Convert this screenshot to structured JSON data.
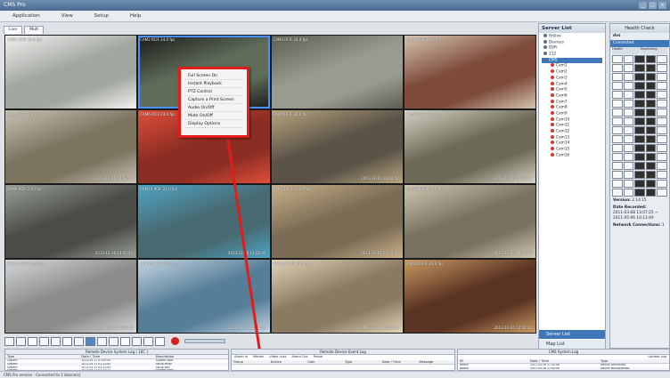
{
  "app": {
    "title": "CMS Pro",
    "win_controls": [
      "_",
      "□",
      "×"
    ]
  },
  "menu": [
    "Application",
    "View",
    "Setup",
    "Help"
  ],
  "tabs": [
    "Live",
    "Mult"
  ],
  "cameras": [
    {
      "label": "CAM1 RCIF 24.0 fps",
      "time": "",
      "bg": "#a1a6a0",
      "accent": "#f2f2f0"
    },
    {
      "label": "CAM2 RCIF 24.0 fps",
      "time": "",
      "bg": "#5f6c5a",
      "accent": "#1a1a18",
      "selected": true
    },
    {
      "label": "CAM3 RCIF 24.0 fps",
      "time": "",
      "bg": "#9a9b90",
      "accent": "#5b5e52"
    },
    {
      "label": "CAM4 RCIF 24.0 fps",
      "time": "",
      "bg": "#7e4a39",
      "accent": "#d5c5b2"
    },
    {
      "label": "CAM5 RCIF 24.0 fps",
      "time": "2013-12-16  14:02:42",
      "bg": "#7d7460",
      "accent": "#c9c3b4"
    },
    {
      "label": "CAM6 RCIF 24.0 fps",
      "time": "",
      "bg": "#8c2d23",
      "accent": "#e14e3a"
    },
    {
      "label": "CAM7 RCIF 24.0 fps",
      "time": "2013-12-16  14:02:42",
      "bg": "#5b5348",
      "accent": "#b9a67e"
    },
    {
      "label": "CAM8 RCIF 24.0 fps",
      "time": "2013-12-16  14:02:42",
      "bg": "#6e6a58",
      "accent": "#d7d3c5"
    },
    {
      "label": "CAM9 RCIF 24.0 fps",
      "time": "2013-12-16  14:02:42",
      "bg": "#4a4c48",
      "accent": "#9aa09a"
    },
    {
      "label": "CAM10 RCIF 24.0 fps",
      "time": "2013-12-16  14:02:42",
      "bg": "#486a72",
      "accent": "#4fa5c6"
    },
    {
      "label": "CAM11 RCIF 24.0 fps",
      "time": "2013-12-16  14:02:42",
      "bg": "#7b6b55",
      "accent": "#c9b18a"
    },
    {
      "label": "CAM12 RCIF 24.0 fps",
      "time": "2013-12-16  14:02:42",
      "bg": "#7a7260",
      "accent": "#d1c8b3"
    },
    {
      "label": "CAM13 RCIF 24.0 fps",
      "time": "2013-12-16  14:02:42",
      "bg": "#8b8c8a",
      "accent": "#d5d8da"
    },
    {
      "label": "CAM14 RCIF 24.0 fps",
      "time": "2013-12-16  14:02:42",
      "bg": "#567e98",
      "accent": "#c6d6e2"
    },
    {
      "label": "CAM15 RCIF 24.0 fps",
      "time": "2013-12-16  14:02:42",
      "bg": "#8a7a62",
      "accent": "#e1d3b8"
    },
    {
      "label": "CAM16 RCIF 24.0 fps",
      "time": "2013-12-16  14:02:42",
      "bg": "#5a3322",
      "accent": "#c99a62"
    }
  ],
  "context_menu": [
    "Full Screen On",
    "Instant Playback",
    "PTZ Control",
    "Capture a Print Screen",
    "Audio On/Off",
    "Mute On/Off",
    "Display Options"
  ],
  "server_list": {
    "title": "Server List",
    "nodes": [
      "Online",
      "Devices",
      "DVR",
      "212",
      "CMS",
      "Cam1",
      "Cam2",
      "Cam3",
      "Cam4",
      "Cam5",
      "Cam6",
      "Cam7",
      "Cam8",
      "Cam9",
      "Cam10",
      "Cam11",
      "Cam12",
      "Cam13",
      "Cam14",
      "Cam15",
      "Cam16"
    ],
    "tabs": [
      "Server List",
      "Map List"
    ]
  },
  "health": {
    "title": "Health Check",
    "server": "dvs",
    "status": "Connected",
    "col_health": "Health",
    "col_monitoring": "Monitoring",
    "version_label": "Version:",
    "version": "2.14.15",
    "date_label": "Date Recorded:",
    "date_value": "2011-03-08 13:07:25 ~ 2011-05-06 10:13:49",
    "network_label": "Network Connections:",
    "network_value": "1"
  },
  "sys_log": {
    "title": "Remote Device System Log ( 16C )",
    "cols": [
      "Type",
      "Date / Time",
      "Description"
    ],
    "rows": [
      [
        "System",
        "2011-05-17 01:00:00",
        "System start"
      ],
      [
        "System",
        "2011-05-17 01:12:00",
        "Setup enter"
      ],
      [
        "System",
        "2011-05-17 01:12:03",
        "Setup exit"
      ],
      [
        "System",
        "2011-05-17 01:12:11",
        "System start"
      ],
      [
        "System",
        "2011-05-17 01:12:17",
        "System shutdown"
      ],
      [
        "System",
        "2011-05-17 03:40:40",
        "Setup enter"
      ],
      [
        "System",
        "2011-05-17 03:41:06",
        "Setup exit"
      ],
      [
        "System",
        "2011-05-17 03:50:09",
        "System start"
      ],
      [
        "System",
        "2011-05-17 03:50:09",
        "System start"
      ]
    ]
  },
  "event_log": {
    "title": "Remote Device Event Log",
    "filters": [
      "Alarm In",
      "Motion",
      "Video Loss",
      "Alarm Out"
    ],
    "pause": "Pause",
    "cols": [
      "Group",
      "Device",
      "Cam",
      "Type",
      "Date / Time",
      "Message"
    ]
  },
  "cms_log": {
    "title": "CMS System Log",
    "update": "Update Log",
    "cols": [
      "ID",
      "Date / Time",
      "Type"
    ],
    "rows": [
      [
        "admin",
        "2011-03-16 17:53:08",
        "Device connected."
      ],
      [
        "admin",
        "2011-03-16 17:45:49",
        "Device disconnected."
      ],
      [
        "admin",
        "2011-03-16 17:40:30",
        "Device setup"
      ],
      [
        "admin",
        "2011-03-16 17:22:40",
        "Device connected."
      ]
    ]
  },
  "status": "CMS Pro version · Connected to 1 device(s)"
}
